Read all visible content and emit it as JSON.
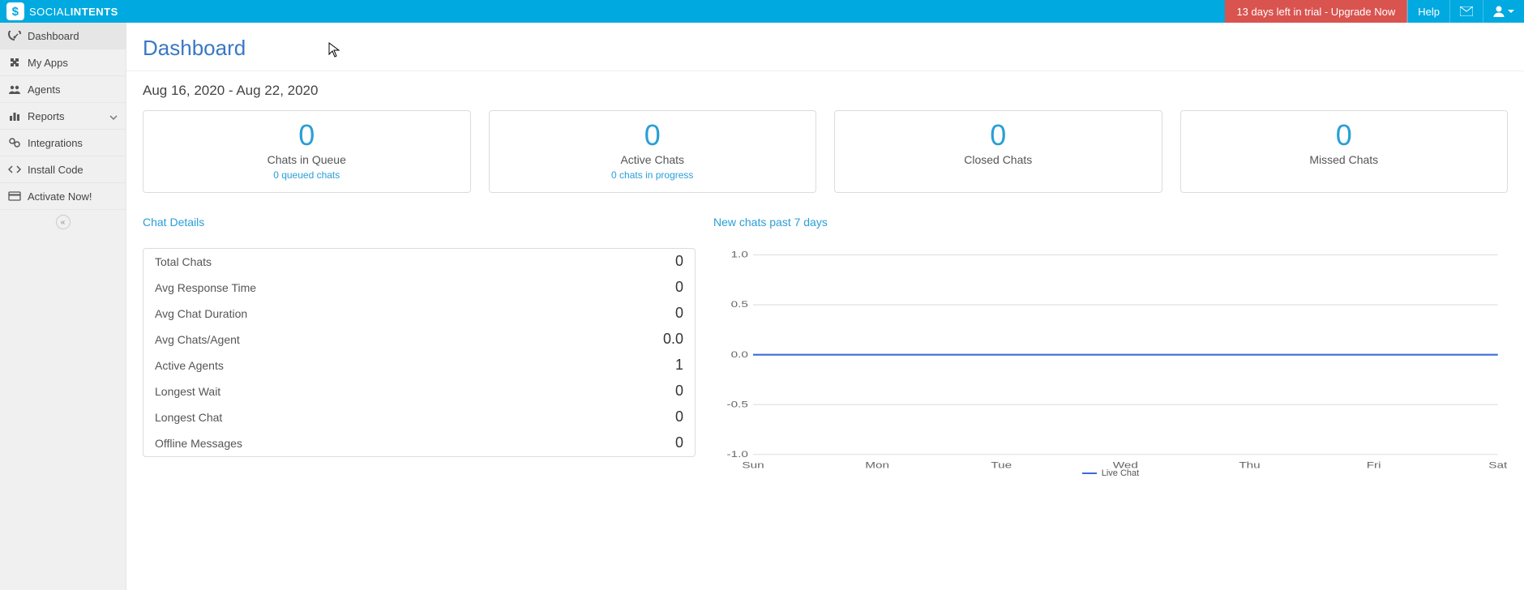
{
  "brand": {
    "part1": "SOCIAL",
    "part2": "INTENTS"
  },
  "topbar": {
    "trial": "13 days left in trial - Upgrade Now",
    "help": "Help"
  },
  "sidebar": {
    "items": [
      {
        "key": "dashboard",
        "label": "Dashboard"
      },
      {
        "key": "myapps",
        "label": "My Apps"
      },
      {
        "key": "agents",
        "label": "Agents"
      },
      {
        "key": "reports",
        "label": "Reports"
      },
      {
        "key": "integrations",
        "label": "Integrations"
      },
      {
        "key": "install",
        "label": "Install Code"
      },
      {
        "key": "activate",
        "label": "Activate Now!"
      }
    ]
  },
  "page": {
    "title": "Dashboard",
    "daterange": "Aug 16, 2020 - Aug 22, 2020"
  },
  "cards": [
    {
      "value": "0",
      "label": "Chats in Queue",
      "sub": "0 queued chats"
    },
    {
      "value": "0",
      "label": "Active Chats",
      "sub": "0 chats in progress"
    },
    {
      "value": "0",
      "label": "Closed Chats",
      "sub": ""
    },
    {
      "value": "0",
      "label": "Missed Chats",
      "sub": ""
    }
  ],
  "sections": {
    "details_title": "Chat Details",
    "chart_title": "New chats past 7 days"
  },
  "details": [
    {
      "label": "Total Chats",
      "value": "0"
    },
    {
      "label": "Avg Response Time",
      "value": "0"
    },
    {
      "label": "Avg Chat Duration",
      "value": "0"
    },
    {
      "label": "Avg Chats/Agent",
      "value": "0.0"
    },
    {
      "label": "Active Agents",
      "value": "1"
    },
    {
      "label": "Longest Wait",
      "value": "0"
    },
    {
      "label": "Longest Chat",
      "value": "0"
    },
    {
      "label": "Offline Messages",
      "value": "0"
    }
  ],
  "chart_data": {
    "type": "line",
    "title": "New chats past 7 days",
    "xlabel": "",
    "ylabel": "",
    "ylim": [
      -1.0,
      1.0
    ],
    "yticks": [
      -1.0,
      -0.5,
      0.0,
      0.5,
      1.0
    ],
    "categories": [
      "Sun",
      "Mon",
      "Tue",
      "Wed",
      "Thu",
      "Fri",
      "Sat"
    ],
    "series": [
      {
        "name": "Live Chat",
        "values": [
          0,
          0,
          0,
          0,
          0,
          0,
          0
        ],
        "color": "#3b6bd4"
      }
    ]
  }
}
